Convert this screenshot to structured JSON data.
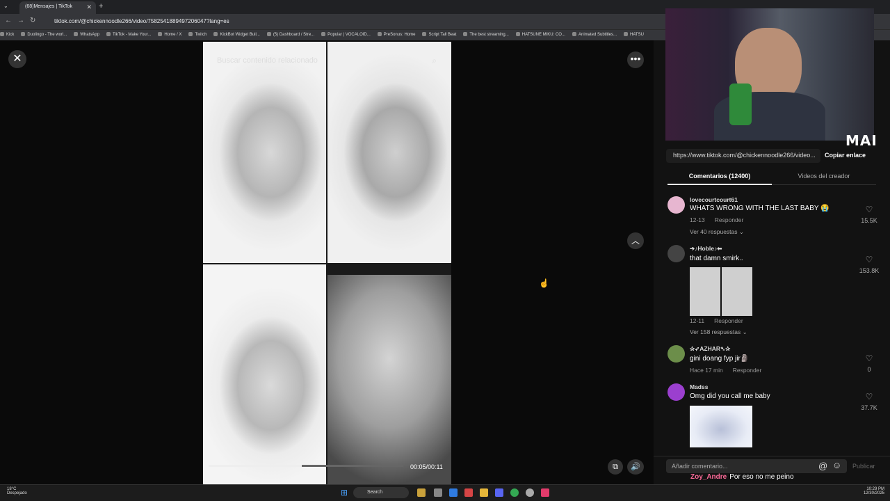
{
  "browser": {
    "tab_title": "(68)Mensajes | TikTok",
    "url": "tiktok.com/@chickennoodle266/video/7582541889497206047?lang=es",
    "bookmarks": [
      "Kick",
      "Duolingo - The worl...",
      "WhatsApp",
      "TikTok - Make Your...",
      "Home / X",
      "Twitch",
      "KickBot Widget Buil...",
      "(5) Dashboard / Stre...",
      "Popular | VOCALOID...",
      "PreSonus: Home",
      "Script Tall Beat",
      "The best streaming...",
      "HATSUNE MIKU: CO...",
      "Animated Subtitles...",
      "HATSU"
    ]
  },
  "player": {
    "search_placeholder": "Buscar contenido relacionado",
    "time": "00:05/00:11",
    "progress": 0.48
  },
  "sidebar": {
    "watermark": "MAI",
    "link": "https://www.tiktok.com/@chickennoodle266/video...",
    "copy_label": "Copiar enlace",
    "tab_comments": "Comentarios (12400)",
    "tab_videos": "Videos del creador",
    "comments": [
      {
        "user": "lovecourtcourt61",
        "text": "WHATS WRONG WITH THE LAST BABY 😭",
        "date": "12-13",
        "reply": "Responder",
        "more": "Ver 40 respuestas ⌄",
        "likes": "15.5K"
      },
      {
        "user": "➔♪Hoble♪⬅",
        "text": "that damn smirk..",
        "date": "12-11",
        "reply": "Responder",
        "more": "Ver 158 respuestas ⌄",
        "likes": "153.8K"
      },
      {
        "user": "✰➶AZHAR➷✰",
        "text": "gini doang fyp jir🗿",
        "date": "Hace 17 min",
        "reply": "Responder",
        "likes": "0"
      },
      {
        "user": "Madss",
        "text": "Omg did you call me baby",
        "likes": "37.7K"
      }
    ],
    "input_placeholder": "Añadir comentario...",
    "publish": "Publicar",
    "chat_user": "Zoy_Andre",
    "chat_text": "Por eso no me peino"
  },
  "taskbar": {
    "temp": "18°C",
    "weather": "Despejado",
    "search": "Search",
    "time": "10:29 PM",
    "date": "12/30/2025"
  }
}
